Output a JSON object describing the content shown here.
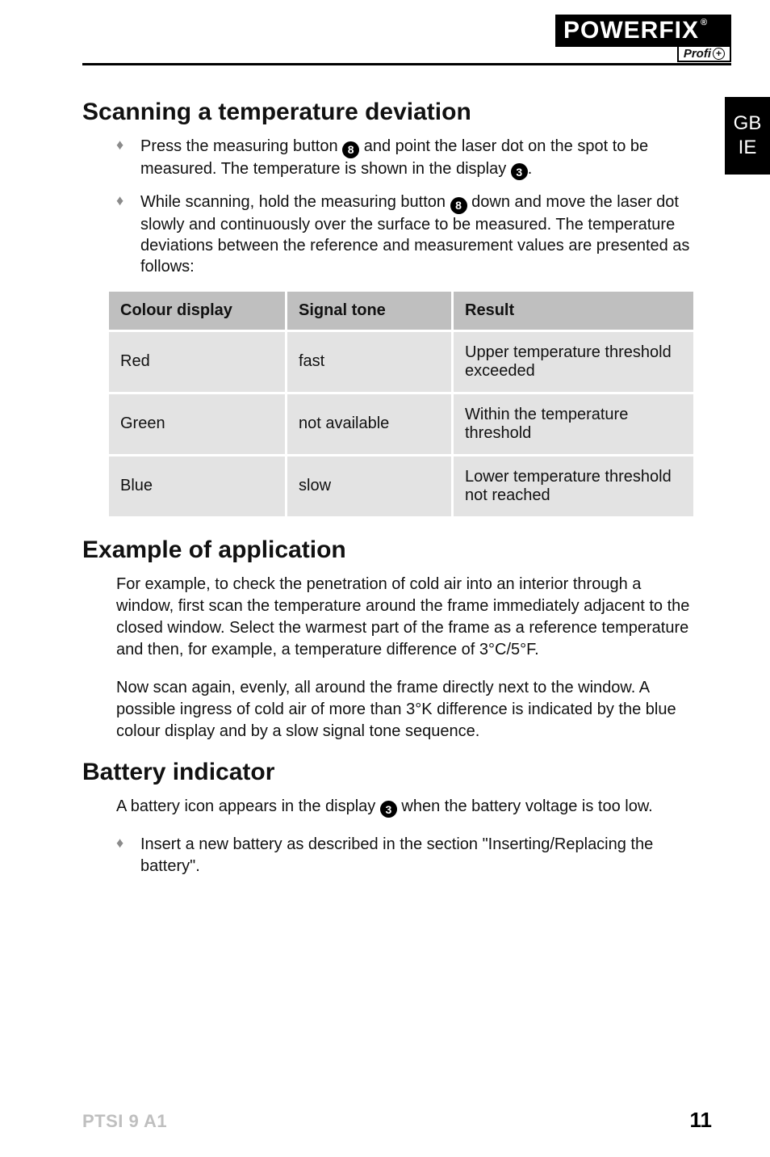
{
  "brand": {
    "name": "POWERFIX",
    "reg": "®",
    "sub_prefix": "Profi",
    "sub_plus": "+"
  },
  "lang_tab": {
    "line1": "GB",
    "line2": "IE"
  },
  "sections": {
    "scanning": {
      "title": "Scanning a temperature deviation",
      "bullets": {
        "b1a": "Press the measuring button ",
        "b1_badge": "8",
        "b1b": " and point the laser dot on the spot to be measured. The temperature is shown in the display ",
        "b1_badge2": "3",
        "b1c": ".",
        "b2a": "While scanning, hold the measuring button ",
        "b2_badge": "8",
        "b2b": " down and move the laser dot slowly and continuously over the surface to be measured. The temperature deviations between the reference and measurement values are presented as follows:"
      },
      "table": {
        "headers": {
          "c1": "Colour display",
          "c2": "Signal tone",
          "c3": "Result"
        },
        "rows": [
          {
            "c1": "Red",
            "c2": "fast",
            "c3": "Upper temperature threshold exceeded"
          },
          {
            "c1": "Green",
            "c2": "not available",
            "c3": "Within the temperature threshold"
          },
          {
            "c1": "Blue",
            "c2": "slow",
            "c3": "Lower temperature threshold not reached"
          }
        ]
      }
    },
    "example": {
      "title": "Example of application",
      "p1": "For example, to check the penetration of cold air into an interior through a window, first scan the temperature around the frame immediately adjacent to the closed window. Select the warmest part of the frame as a reference temperature and then, for example, a temperature difference of 3°C/5°F.",
      "p2": "Now scan again, evenly, all around the frame directly next to the window. A possible ingress of cold air of more than 3°K difference is indicated by the blue colour display and by a slow signal tone sequence."
    },
    "battery": {
      "title": "Battery indicator",
      "p1a": "A battery icon appears in the display ",
      "p1_badge": "3",
      "p1b": " when the battery voltage is too low.",
      "bullet": "Insert a new battery as described in the section \"Inserting/Replacing the battery\"."
    }
  },
  "footer": {
    "left": "PTSI 9 A1",
    "right": "11"
  }
}
